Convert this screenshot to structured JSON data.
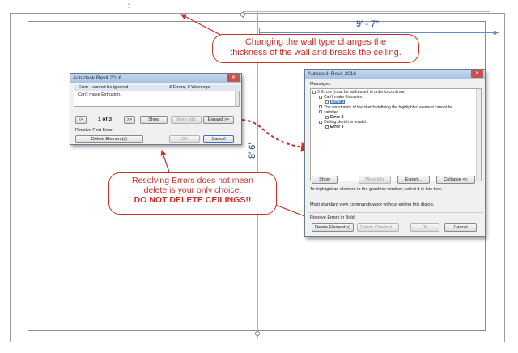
{
  "drawing": {
    "horizontal_dimension": "9' - 7\"",
    "vertical_dimension": "8' 6\"",
    "top_marker": "⟟"
  },
  "callouts": {
    "wall_type": {
      "line1": "Changing the wall type changes the",
      "line2": "thickness of the wall and breaks the ceiling."
    },
    "resolve": {
      "line1": "Resolving Errors does not mean",
      "line2": "delete is your only choice.",
      "line3": "DO NOT DELETE CEILINGS!!"
    },
    "color": "#c9302c"
  },
  "small_dialog": {
    "title": "Autodesk Revit 2016",
    "close_icon": "close-icon",
    "header_left": "Error - cannot be ignored",
    "header_sep": "—",
    "header_right": "3 Errors, 0 Warnings",
    "message": "Can't make Extrusion.",
    "prev_label": "<<",
    "counter": "1 of 3",
    "next_label": ">>",
    "show_label": "Show",
    "more_info_label": "More Info",
    "expand_label": "Expand >>",
    "resolve_label": "Resolve First Error:",
    "delete_label": "Delete Element(s)",
    "ok_label": "OK",
    "cancel_label": "Cancel"
  },
  "large_dialog": {
    "title": "Autodesk Revit 2016",
    "close_icon": "close-icon",
    "messages_label": "Messages",
    "tree": [
      {
        "level": 0,
        "text": "3 Errors (must be addressed in order to continue)",
        "selected": false
      },
      {
        "level": 1,
        "text": "Can't make Extrusion.",
        "selected": false
      },
      {
        "level": 2,
        "text": "Error 1",
        "selected": true
      },
      {
        "level": 1,
        "text": "The constraints of the sketch defining the highlighted element cannot be",
        "selected": false
      },
      {
        "level": 1,
        "text": "satisfied.",
        "selected": false
      },
      {
        "level": 2,
        "text": "Error 2",
        "selected": false
      },
      {
        "level": 1,
        "text": "Ceiling sketch is invalid.",
        "selected": false
      },
      {
        "level": 2,
        "text": "Error 3",
        "selected": false
      }
    ],
    "show_label": "Show",
    "more_info_label": "More Info",
    "export_label": "Export...",
    "collapse_label": "Collapse <<",
    "hint1": "To highlight an element in the graphics window, select it in this tree.",
    "hint2": "Most standard view commands work without exiting this dialog.",
    "resolve_label": "Resolve Errors in Bold:",
    "delete_label": "Delete Element(s)",
    "delete_checked_label": "Delete Checked...",
    "ok_label": "OK",
    "cancel_label": "Cancel"
  }
}
